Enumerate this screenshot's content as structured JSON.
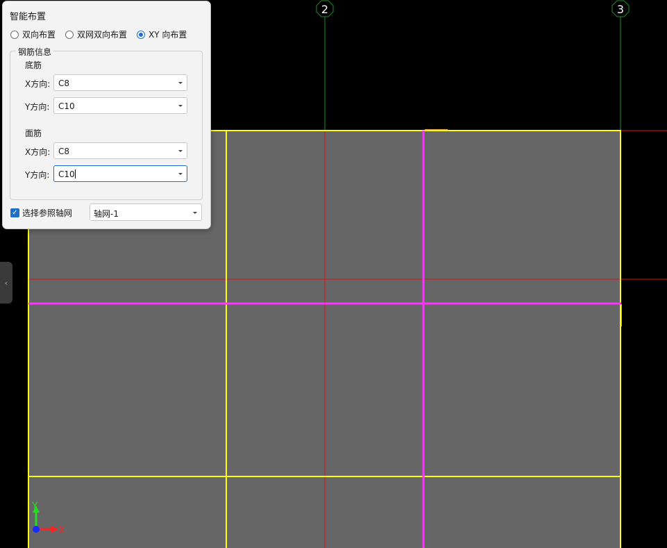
{
  "axes_labels": {
    "axis2": "2",
    "axis3": "3"
  },
  "ucs": {
    "y": "Y",
    "x": "X"
  },
  "panel": {
    "title": "智能布置",
    "radios": [
      {
        "label": "双向布置",
        "selected": false
      },
      {
        "label": "双网双向布置",
        "selected": false
      },
      {
        "label": "XY 向布置",
        "selected": true
      }
    ],
    "rebar_group": {
      "legend": "钢筋信息",
      "bottom": {
        "title": "底筋",
        "x_label": "X方向:",
        "x_value": "C8",
        "y_label": "Y方向:",
        "y_value": "C10"
      },
      "top": {
        "title": "面筋",
        "x_label": "X方向:",
        "x_value": "C8",
        "y_label": "Y方向:",
        "y_value": "C10"
      }
    },
    "ref_grid": {
      "checkbox_label": "选择参照轴网",
      "checked": true,
      "value": "轴网-1"
    }
  },
  "colors": {
    "slab": "#666666",
    "beam": "#ffff00",
    "rebar": "#ff33ff",
    "axis_line": "#dd1111",
    "axis_green": "#1a8f2a"
  }
}
